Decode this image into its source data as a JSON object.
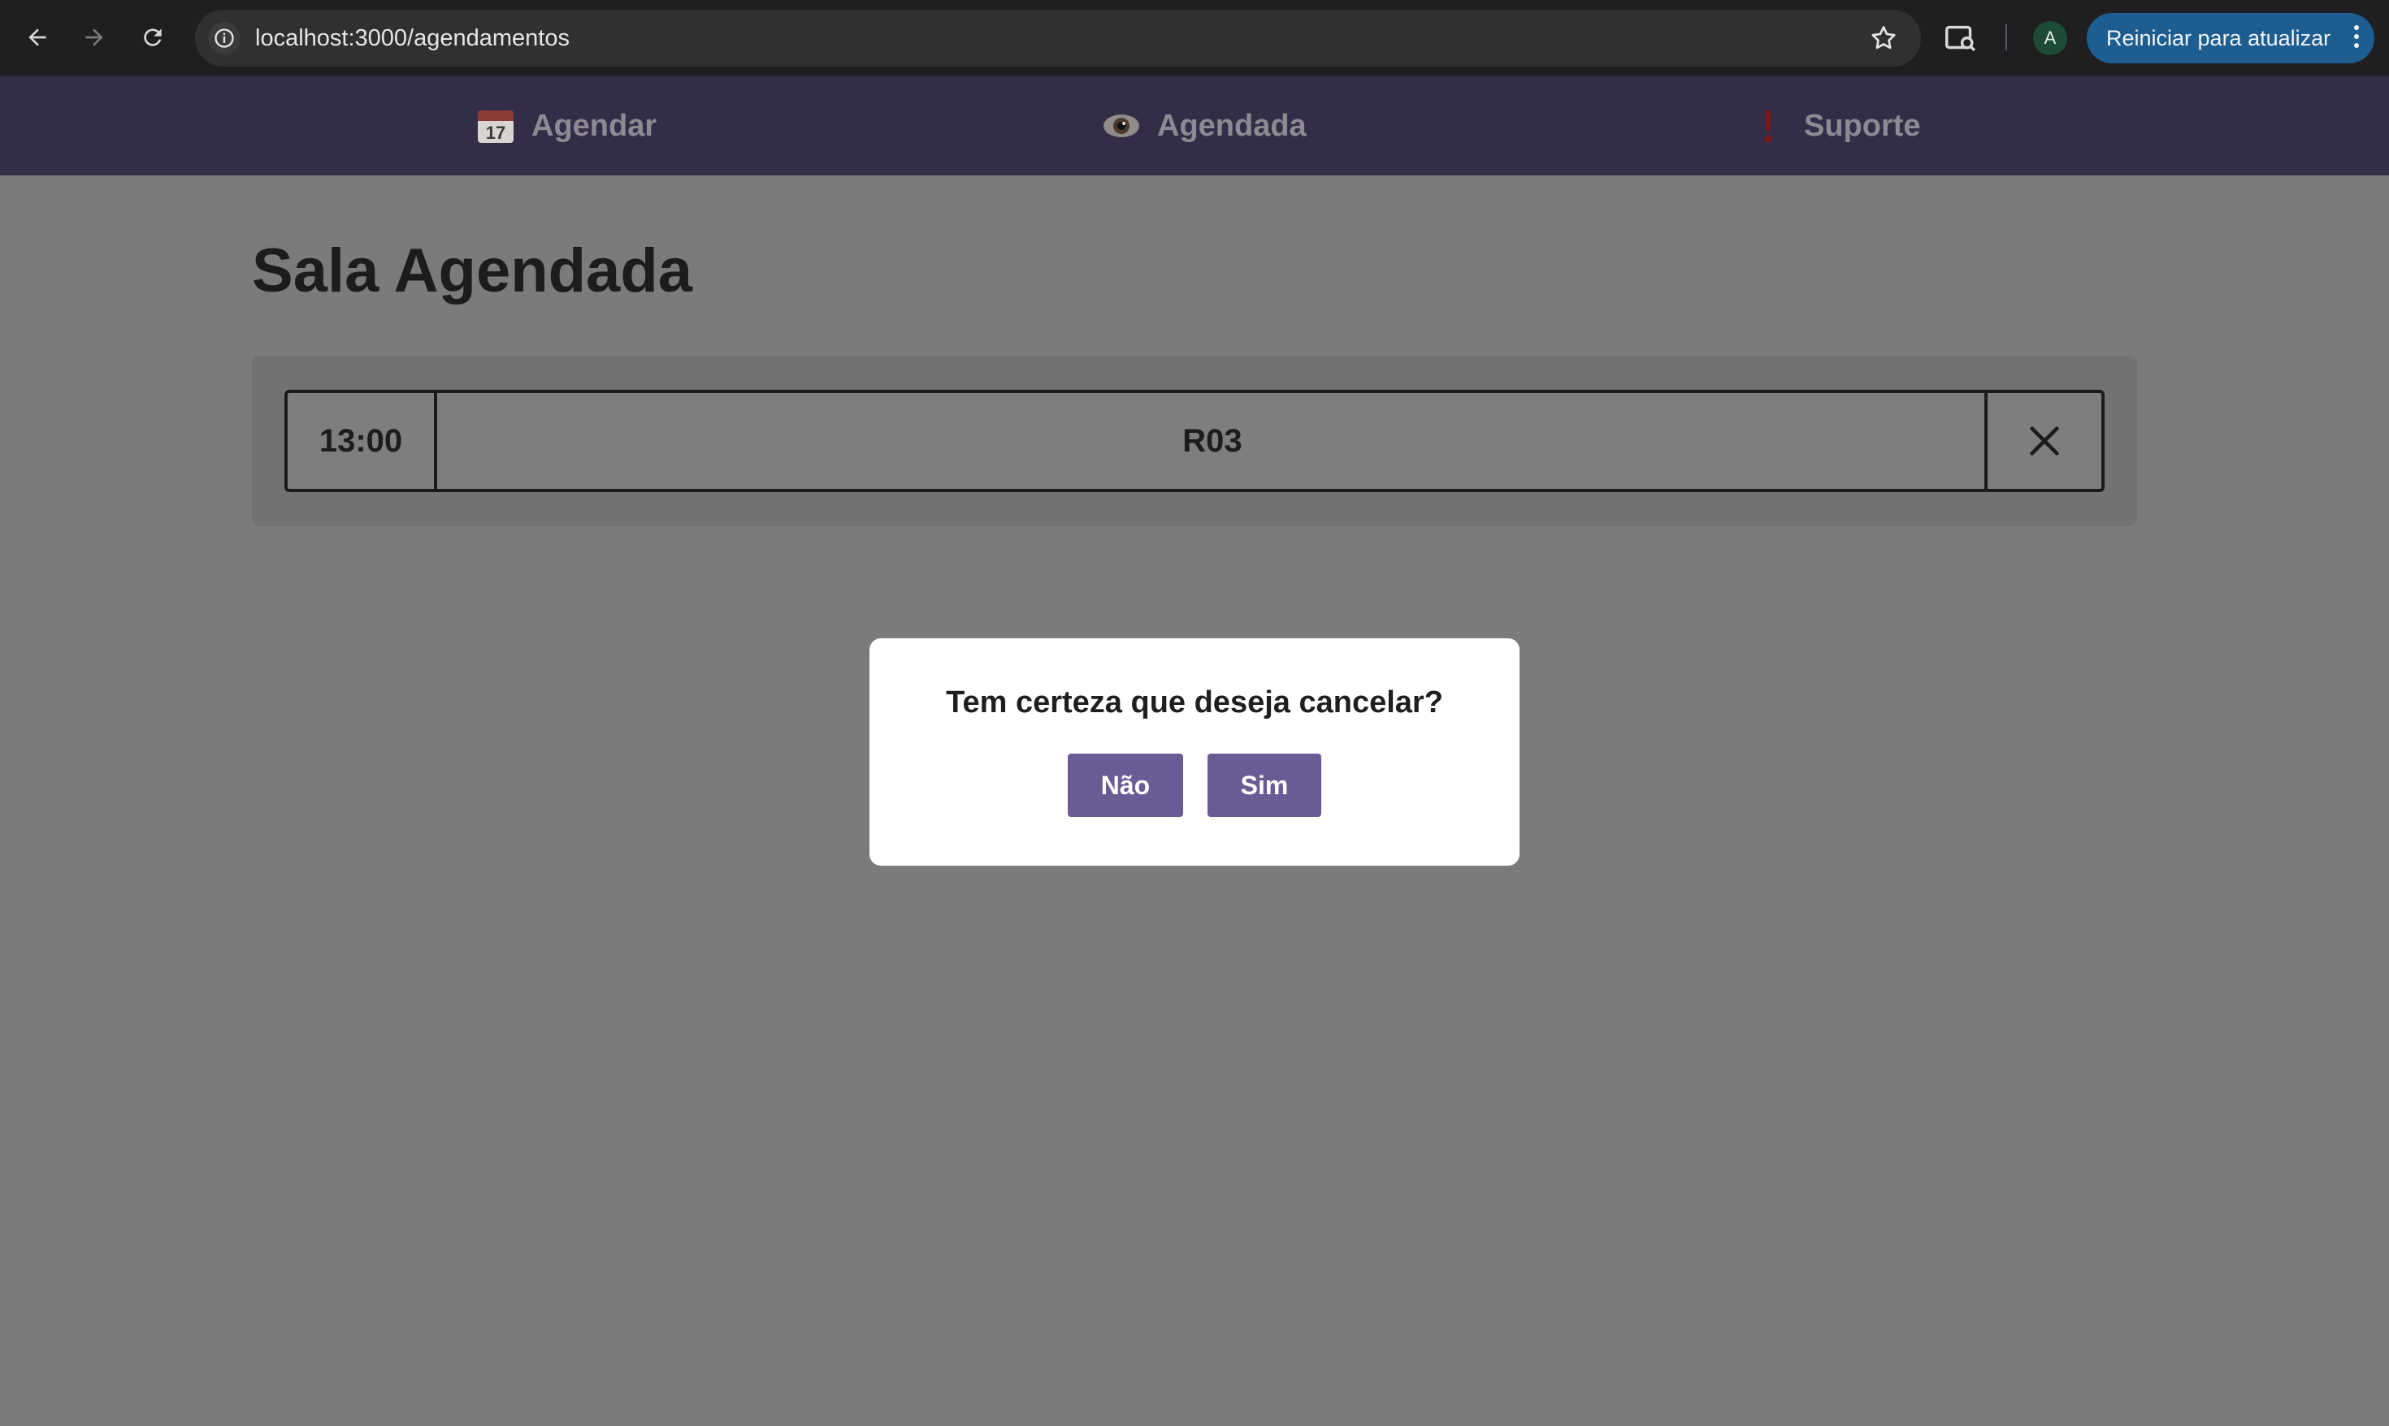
{
  "browser": {
    "url": "localhost:3000/agendamentos",
    "profile_initial": "A",
    "update_button_label": "Reiniciar para atualizar"
  },
  "nav": {
    "items": [
      {
        "label": "Agendar",
        "icon": "calendar-icon"
      },
      {
        "label": "Agendada",
        "icon": "eye-icon"
      },
      {
        "label": "Suporte",
        "icon": "exclamation-icon"
      }
    ]
  },
  "main": {
    "title": "Sala Agendada",
    "bookings": [
      {
        "time": "13:00",
        "room": "R03"
      }
    ]
  },
  "modal": {
    "question": "Tem certeza que deseja cancelar?",
    "no_label": "Não",
    "yes_label": "Sim"
  },
  "colors": {
    "nav_background": "#342d48",
    "button_purple": "#6a5b94",
    "overlay_gray": "#7b7b7b",
    "update_button": "#1d5d8f"
  }
}
